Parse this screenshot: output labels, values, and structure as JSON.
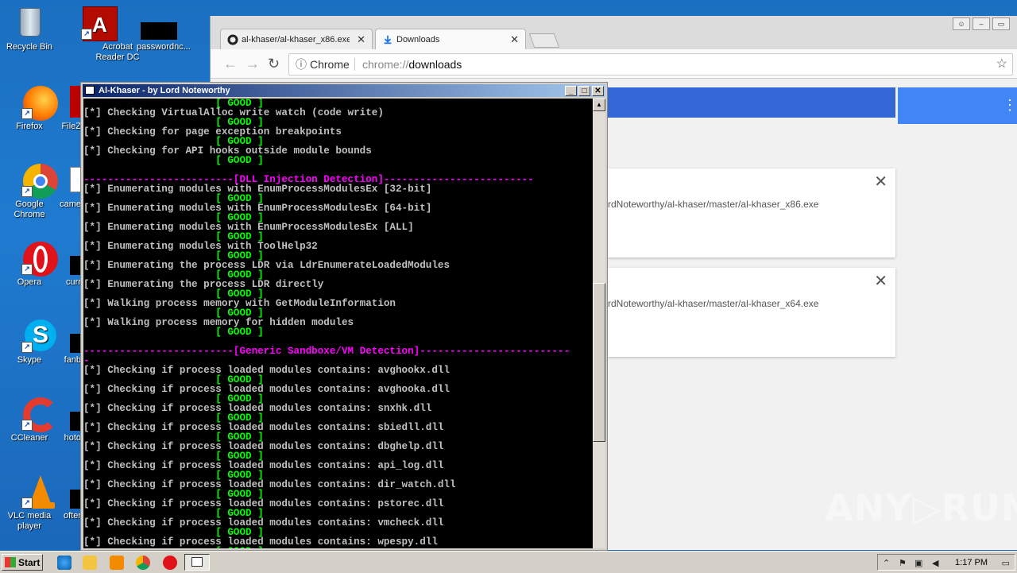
{
  "desktop": {
    "icons": [
      {
        "label": "Recycle Bin",
        "icon": "recycle-bin-icon"
      },
      {
        "label": "Acrobat Reader DC",
        "icon": "acrobat-icon"
      },
      {
        "label": "passwordnc...",
        "icon": "file-icon"
      },
      {
        "label": "Firefox",
        "icon": "firefox-icon"
      },
      {
        "label": "FileZ",
        "icon": "filezilla-icon"
      },
      {
        "label": "Google Chrome",
        "icon": "chrome-icon"
      },
      {
        "label": "came",
        "icon": "file-icon"
      },
      {
        "label": "Opera",
        "icon": "opera-icon"
      },
      {
        "label": "curr",
        "icon": "file-icon"
      },
      {
        "label": "Skype",
        "icon": "skype-icon"
      },
      {
        "label": "fanb",
        "icon": "file-icon"
      },
      {
        "label": "CCleaner",
        "icon": "ccleaner-icon"
      },
      {
        "label": "hoto",
        "icon": "file-icon"
      },
      {
        "label": "VLC media player",
        "icon": "vlc-icon"
      },
      {
        "label": "ofter",
        "icon": "file-icon"
      }
    ]
  },
  "chrome": {
    "tabs": [
      {
        "label": "al-khaser/al-khaser_x86.exe",
        "close": "✕"
      },
      {
        "label": "Downloads",
        "close": "✕"
      }
    ],
    "omnibox": {
      "chip": "Chrome",
      "url_prefix": "chrome://",
      "url_path": "downloads"
    },
    "downloads": [
      {
        "url": "rdNoteworthy/al-khaser/master/al-khaser_x86.exe"
      },
      {
        "url": "rdNoteworthy/al-khaser/master/al-khaser_x64.exe"
      }
    ]
  },
  "console": {
    "title": "Al-Khaser - by Lord Noteworthy",
    "lines": [
      {
        "t": "g",
        "text": "                      [ GOOD ]"
      },
      {
        "t": "t",
        "text": "[*] Checking VirtualAlloc write watch (code write)"
      },
      {
        "t": "g",
        "text": "                      [ GOOD ]"
      },
      {
        "t": "t",
        "text": "[*] Checking for page exception breakpoints"
      },
      {
        "t": "g",
        "text": "                      [ GOOD ]"
      },
      {
        "t": "t",
        "text": "[*] Checking for API hooks outside module bounds"
      },
      {
        "t": "g",
        "text": "                      [ GOOD ]"
      },
      {
        "t": "t",
        "text": ""
      },
      {
        "t": "m",
        "text": "-------------------------[DLL Injection Detection]-------------------------"
      },
      {
        "t": "t",
        "text": "[*] Enumerating modules with EnumProcessModulesEx [32-bit]"
      },
      {
        "t": "g",
        "text": "                      [ GOOD ]"
      },
      {
        "t": "t",
        "text": "[*] Enumerating modules with EnumProcessModulesEx [64-bit]"
      },
      {
        "t": "g",
        "text": "                      [ GOOD ]"
      },
      {
        "t": "t",
        "text": "[*] Enumerating modules with EnumProcessModulesEx [ALL]"
      },
      {
        "t": "g",
        "text": "                      [ GOOD ]"
      },
      {
        "t": "t",
        "text": "[*] Enumerating modules with ToolHelp32"
      },
      {
        "t": "g",
        "text": "                      [ GOOD ]"
      },
      {
        "t": "t",
        "text": "[*] Enumerating the process LDR via LdrEnumerateLoadedModules"
      },
      {
        "t": "g",
        "text": "                      [ GOOD ]"
      },
      {
        "t": "t",
        "text": "[*] Enumerating the process LDR directly"
      },
      {
        "t": "g",
        "text": "                      [ GOOD ]"
      },
      {
        "t": "t",
        "text": "[*] Walking process memory with GetModuleInformation"
      },
      {
        "t": "g",
        "text": "                      [ GOOD ]"
      },
      {
        "t": "t",
        "text": "[*] Walking process memory for hidden modules"
      },
      {
        "t": "g",
        "text": "                      [ GOOD ]"
      },
      {
        "t": "t",
        "text": ""
      },
      {
        "t": "m",
        "text": "-------------------------[Generic Sandboxe/VM Detection]-------------------------"
      },
      {
        "t": "m",
        "text": "-"
      },
      {
        "t": "t",
        "text": "[*] Checking if process loaded modules contains: avghookx.dll"
      },
      {
        "t": "g",
        "text": "                      [ GOOD ]"
      },
      {
        "t": "t",
        "text": "[*] Checking if process loaded modules contains: avghooka.dll"
      },
      {
        "t": "g",
        "text": "                      [ GOOD ]"
      },
      {
        "t": "t",
        "text": "[*] Checking if process loaded modules contains: snxhk.dll"
      },
      {
        "t": "g",
        "text": "                      [ GOOD ]"
      },
      {
        "t": "t",
        "text": "[*] Checking if process loaded modules contains: sbiedll.dll"
      },
      {
        "t": "g",
        "text": "                      [ GOOD ]"
      },
      {
        "t": "t",
        "text": "[*] Checking if process loaded modules contains: dbghelp.dll"
      },
      {
        "t": "g",
        "text": "                      [ GOOD ]"
      },
      {
        "t": "t",
        "text": "[*] Checking if process loaded modules contains: api_log.dll"
      },
      {
        "t": "g",
        "text": "                      [ GOOD ]"
      },
      {
        "t": "t",
        "text": "[*] Checking if process loaded modules contains: dir_watch.dll"
      },
      {
        "t": "g",
        "text": "                      [ GOOD ]"
      },
      {
        "t": "t",
        "text": "[*] Checking if process loaded modules contains: pstorec.dll"
      },
      {
        "t": "g",
        "text": "                      [ GOOD ]"
      },
      {
        "t": "t",
        "text": "[*] Checking if process loaded modules contains: vmcheck.dll"
      },
      {
        "t": "g",
        "text": "                      [ GOOD ]"
      },
      {
        "t": "t",
        "text": "[*] Checking if process loaded modules contains: wpespy.dll"
      },
      {
        "t": "g",
        "text": "                      [ GOOD ]"
      }
    ]
  },
  "taskbar": {
    "start_label": "Start",
    "clock": "1:17 PM"
  },
  "watermark": "ANY▷RUN",
  "colors": {
    "console_text": "#c0c0c0",
    "console_good": "#00ff00",
    "console_section": "#ff00ff",
    "chrome_header": "#3367d6"
  }
}
